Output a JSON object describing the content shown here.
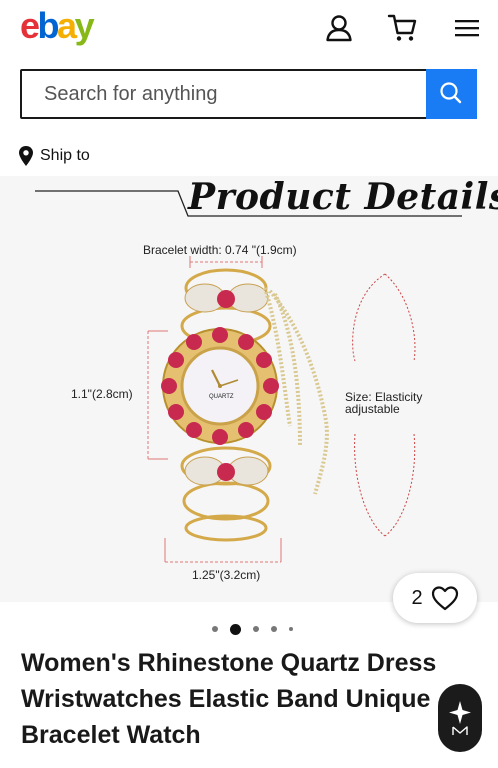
{
  "header": {
    "logo_letters": [
      "e",
      "b",
      "a",
      "y"
    ],
    "logo_colors": [
      "#e53238",
      "#0064d2",
      "#f5af02",
      "#86b817"
    ],
    "icons": [
      "user-icon",
      "cart-icon",
      "menu-icon"
    ]
  },
  "search": {
    "placeholder": "Search for anything",
    "button_color": "#1a7cf5",
    "button_icon": "search-icon"
  },
  "shipping": {
    "label": "Ship to",
    "icon": "location-pin-icon"
  },
  "gallery": {
    "image": {
      "heading": "Product Details",
      "bracelet_width": "Bracelet width: 0.74 \"(1.9cm)",
      "dial_height": "1.1\"(2.8cm)",
      "bottom_width": "1.25\"(3.2cm)",
      "size_label": "Size: Elasticity",
      "size_label_2": "adjustable",
      "dial_brand": "QUARTZ"
    },
    "like_count": "2",
    "dots_total": 5,
    "dots_active_index": 1
  },
  "listing": {
    "title": "Women's Rhinestone Quartz Dress Wristwatches Elastic Band Unique Bracelet Watch"
  }
}
